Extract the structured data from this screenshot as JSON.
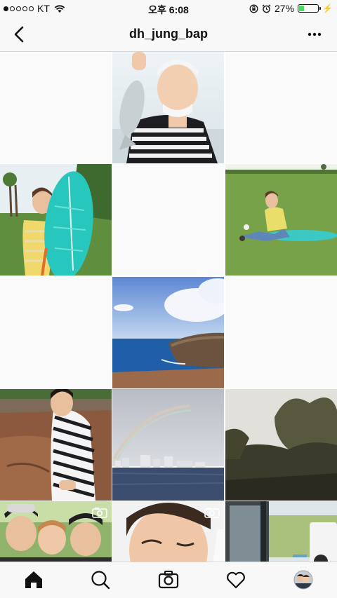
{
  "status": {
    "carrier": "KT",
    "time": "오후 6:08",
    "battery_text": "27%",
    "battery_level": 0.27,
    "signal_bars_filled": 1,
    "signal_bars_total": 5
  },
  "nav": {
    "title": "dh_jung_bap",
    "back_icon": "chevron-left-icon",
    "more_icon": "more-horizontal-icon"
  },
  "grid": {
    "tiles": [
      {
        "kind": "empty"
      },
      {
        "kind": "photo",
        "subject": "person holding fish"
      },
      {
        "kind": "empty"
      },
      {
        "kind": "photo",
        "subject": "person with turquoise surfboard"
      },
      {
        "kind": "empty"
      },
      {
        "kind": "photo",
        "subject": "person sitting on lawn mat"
      },
      {
        "kind": "empty"
      },
      {
        "kind": "photo",
        "subject": "ocean cliff coastline"
      },
      {
        "kind": "empty"
      },
      {
        "kind": "photo",
        "subject": "person in striped shirt on rocks"
      },
      {
        "kind": "photo",
        "subject": "rainbow over city skyline"
      },
      {
        "kind": "photo",
        "subject": "blurry tree landscape"
      },
      {
        "kind": "photo",
        "subject": "group selfie",
        "video": true
      },
      {
        "kind": "photo",
        "subject": "winking selfie",
        "video": true
      },
      {
        "kind": "photo",
        "subject": "van door and park"
      }
    ]
  },
  "tabbar": {
    "items": [
      {
        "name": "home",
        "icon": "home-icon",
        "active": true
      },
      {
        "name": "search",
        "icon": "search-icon"
      },
      {
        "name": "camera",
        "icon": "camera-icon"
      },
      {
        "name": "activity",
        "icon": "heart-icon"
      },
      {
        "name": "profile",
        "icon": "avatar"
      }
    ]
  },
  "colors": {
    "bar_background": "#f8f8f8",
    "divider": "#d6d6d6",
    "empty_tile": "#fafafa",
    "battery_fill": "#4cd964"
  }
}
